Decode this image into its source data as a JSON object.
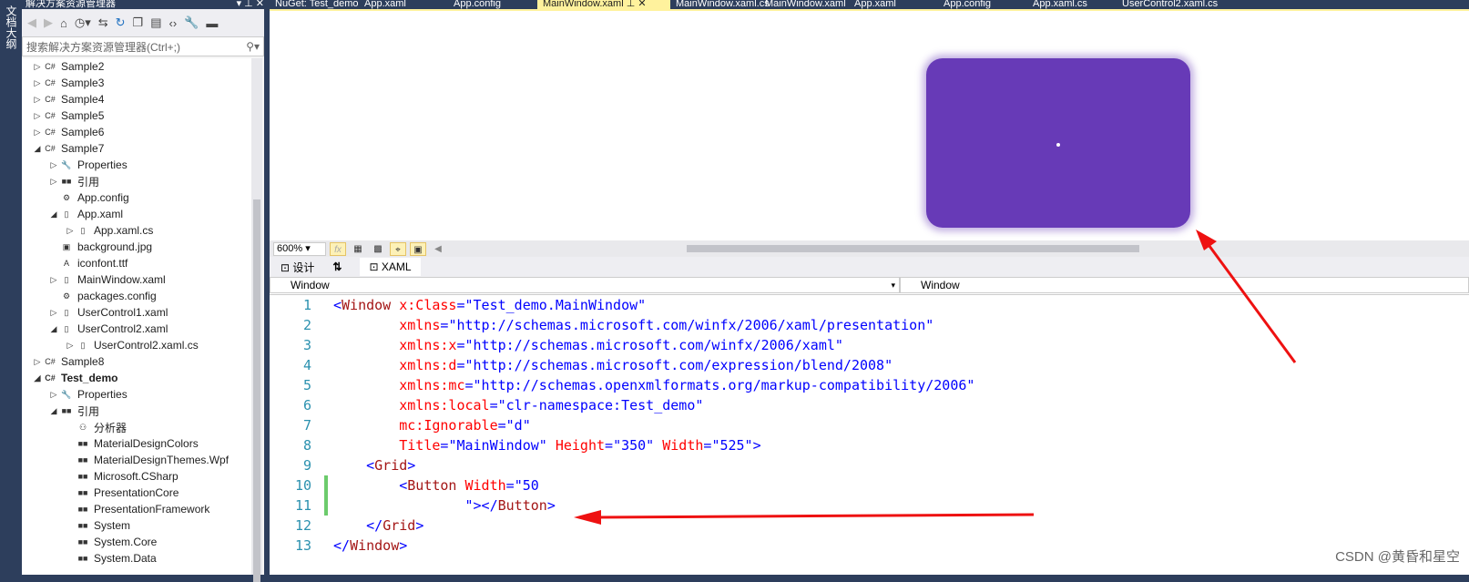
{
  "left_strip": "文档大纲",
  "solution_explorer": {
    "title": "解决方案资源管理器",
    "title_buttons": "▾ ⊥ ✕",
    "search_placeholder": "搜索解决方案资源管理器(Ctrl+;)",
    "tree": [
      {
        "label": "Sample2",
        "level": 0,
        "exp": "▷",
        "icon": "C#"
      },
      {
        "label": "Sample3",
        "level": 0,
        "exp": "▷",
        "icon": "C#"
      },
      {
        "label": "Sample4",
        "level": 0,
        "exp": "▷",
        "icon": "C#"
      },
      {
        "label": "Sample5",
        "level": 0,
        "exp": "▷",
        "icon": "C#"
      },
      {
        "label": "Sample6",
        "level": 0,
        "exp": "▷",
        "icon": "C#"
      },
      {
        "label": "Sample7",
        "level": 0,
        "exp": "◢",
        "icon": "C#"
      },
      {
        "label": "Properties",
        "level": 1,
        "exp": "▷",
        "icon": "🔧"
      },
      {
        "label": "引用",
        "level": 1,
        "exp": "▷",
        "icon": "■■"
      },
      {
        "label": "App.config",
        "level": 1,
        "exp": "",
        "icon": "⚙"
      },
      {
        "label": "App.xaml",
        "level": 1,
        "exp": "◢",
        "icon": "▯"
      },
      {
        "label": "App.xaml.cs",
        "level": 2,
        "exp": "▷",
        "icon": "▯"
      },
      {
        "label": "background.jpg",
        "level": 1,
        "exp": "",
        "icon": "▣"
      },
      {
        "label": "iconfont.ttf",
        "level": 1,
        "exp": "",
        "icon": "A"
      },
      {
        "label": "MainWindow.xaml",
        "level": 1,
        "exp": "▷",
        "icon": "▯"
      },
      {
        "label": "packages.config",
        "level": 1,
        "exp": "",
        "icon": "⚙"
      },
      {
        "label": "UserControl1.xaml",
        "level": 1,
        "exp": "▷",
        "icon": "▯"
      },
      {
        "label": "UserControl2.xaml",
        "level": 1,
        "exp": "◢",
        "icon": "▯"
      },
      {
        "label": "UserControl2.xaml.cs",
        "level": 2,
        "exp": "▷",
        "icon": "▯"
      },
      {
        "label": "Sample8",
        "level": 0,
        "exp": "▷",
        "icon": "C#"
      },
      {
        "label": "Test_demo",
        "level": 0,
        "exp": "◢",
        "icon": "C#",
        "bold": true
      },
      {
        "label": "Properties",
        "level": 1,
        "exp": "▷",
        "icon": "🔧"
      },
      {
        "label": "引用",
        "level": 1,
        "exp": "◢",
        "icon": "■■"
      },
      {
        "label": "分析器",
        "level": 2,
        "exp": "",
        "icon": "⚇"
      },
      {
        "label": "MaterialDesignColors",
        "level": 2,
        "exp": "",
        "icon": "■■"
      },
      {
        "label": "MaterialDesignThemes.Wpf",
        "level": 2,
        "exp": "",
        "icon": "■■"
      },
      {
        "label": "Microsoft.CSharp",
        "level": 2,
        "exp": "",
        "icon": "■■"
      },
      {
        "label": "PresentationCore",
        "level": 2,
        "exp": "",
        "icon": "■■"
      },
      {
        "label": "PresentationFramework",
        "level": 2,
        "exp": "",
        "icon": "■■"
      },
      {
        "label": "System",
        "level": 2,
        "exp": "",
        "icon": "■■"
      },
      {
        "label": "System.Core",
        "level": 2,
        "exp": "",
        "icon": "■■"
      },
      {
        "label": "System.Data",
        "level": 2,
        "exp": "",
        "icon": "■■"
      }
    ]
  },
  "tabs": [
    {
      "label": "NuGet: Test_demo"
    },
    {
      "label": "App.xaml"
    },
    {
      "label": "App.config"
    },
    {
      "label": "MainWindow.xaml  ⊥ ✕",
      "active": true
    },
    {
      "label": "MainWindow.xaml.cs"
    },
    {
      "label": "MainWindow.xaml"
    },
    {
      "label": "App.xaml"
    },
    {
      "label": "App.config"
    },
    {
      "label": "App.xaml.cs"
    },
    {
      "label": "UserControl2.xaml.cs"
    }
  ],
  "designer": {
    "preview_color": "#673ab7",
    "zoom": "600%"
  },
  "view_tabs": {
    "design": "设计",
    "swap": "⇅",
    "xaml": "XAML"
  },
  "nav": {
    "left": "Window",
    "right": "Window"
  },
  "code": [
    {
      "n": "1",
      "seg": [
        [
          "p",
          "<"
        ],
        [
          "t",
          "Window"
        ],
        [
          "a",
          " x:Class"
        ],
        [
          "p",
          "="
        ],
        [
          "v",
          "\"Test_demo.MainWindow\""
        ]
      ]
    },
    {
      "n": "2",
      "seg": [
        [
          "a",
          "        xmlns"
        ],
        [
          "p",
          "="
        ],
        [
          "v",
          "\"http://schemas.microsoft.com/winfx/2006/xaml/presentation\""
        ]
      ]
    },
    {
      "n": "3",
      "seg": [
        [
          "a",
          "        xmlns:x"
        ],
        [
          "p",
          "="
        ],
        [
          "v",
          "\"http://schemas.microsoft.com/winfx/2006/xaml\""
        ]
      ]
    },
    {
      "n": "4",
      "seg": [
        [
          "a",
          "        xmlns:d"
        ],
        [
          "p",
          "="
        ],
        [
          "v",
          "\"http://schemas.microsoft.com/expression/blend/2008\""
        ]
      ]
    },
    {
      "n": "5",
      "seg": [
        [
          "a",
          "        xmlns:mc"
        ],
        [
          "p",
          "="
        ],
        [
          "v",
          "\"http://schemas.openxmlformats.org/markup-compatibility/2006\""
        ]
      ]
    },
    {
      "n": "6",
      "seg": [
        [
          "a",
          "        xmlns:local"
        ],
        [
          "p",
          "="
        ],
        [
          "v",
          "\"clr-namespace:Test_demo\""
        ]
      ]
    },
    {
      "n": "7",
      "seg": [
        [
          "a",
          "        mc:Ignorable"
        ],
        [
          "p",
          "="
        ],
        [
          "v",
          "\"d\""
        ]
      ]
    },
    {
      "n": "8",
      "seg": [
        [
          "a",
          "        Title"
        ],
        [
          "p",
          "="
        ],
        [
          "v",
          "\"MainWindow\""
        ],
        [
          "a",
          " Height"
        ],
        [
          "p",
          "="
        ],
        [
          "v",
          "\"350\""
        ],
        [
          "a",
          " Width"
        ],
        [
          "p",
          "="
        ],
        [
          "v",
          "\"525\""
        ],
        [
          "p",
          ">"
        ]
      ]
    },
    {
      "n": "9",
      "seg": [
        [
          "p",
          "    <"
        ],
        [
          "t",
          "Grid"
        ],
        [
          "p",
          ">"
        ]
      ]
    },
    {
      "n": "10",
      "mod": true,
      "seg": [
        [
          "p",
          "        <"
        ],
        [
          "t",
          "Button"
        ],
        [
          "a",
          " Width"
        ],
        [
          "p",
          "="
        ],
        [
          "v",
          "\"50"
        ]
      ]
    },
    {
      "n": "11",
      "mod": true,
      "seg": [
        [
          "v",
          "                \""
        ],
        [
          "p",
          "></"
        ],
        [
          "t",
          "Button"
        ],
        [
          "p",
          ">"
        ]
      ]
    },
    {
      "n": "12",
      "seg": [
        [
          "p",
          "    </"
        ],
        [
          "t",
          "Grid"
        ],
        [
          "p",
          ">"
        ]
      ]
    },
    {
      "n": "13",
      "seg": [
        [
          "p",
          "</"
        ],
        [
          "t",
          "Window"
        ],
        [
          "p",
          ">"
        ]
      ]
    }
  ],
  "watermark": "CSDN @黄昏和星空"
}
